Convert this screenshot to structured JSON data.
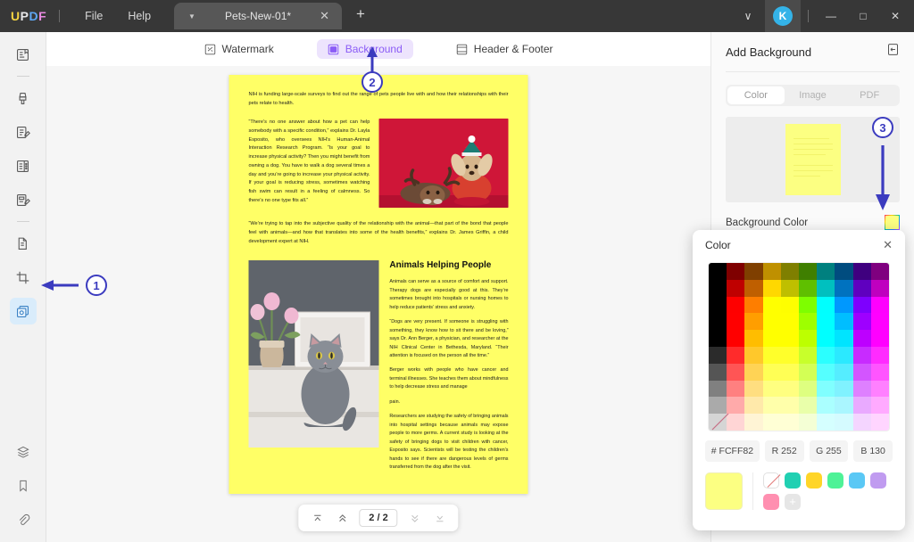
{
  "titlebar": {
    "logo": {
      "u": "U",
      "p": "P",
      "d": "D",
      "f": "F"
    },
    "menus": [
      "File",
      "Help"
    ],
    "tab": {
      "title": "Pets-New-01*",
      "caret_icon": "chevron-down-icon",
      "close_icon": "close-icon"
    },
    "new_tab_label": "+",
    "account_initial": "K",
    "window_buttons": {
      "minimize": "—",
      "maximize": "□",
      "close": "✕"
    },
    "overflow_caret": "∨"
  },
  "sidebar": {
    "items": [
      {
        "name": "reader-icon",
        "label": "Reader"
      },
      {
        "name": "annotate-icon",
        "label": "Annotate"
      },
      {
        "name": "edit-pdf-icon",
        "label": "Edit PDF"
      },
      {
        "name": "organize-pages-icon",
        "label": "Organize Pages"
      },
      {
        "name": "form-icon",
        "label": "Form"
      },
      {
        "name": "convert-pdf-icon",
        "label": "Convert PDF"
      },
      {
        "name": "crop-icon",
        "label": "Crop"
      },
      {
        "name": "page-background-icon",
        "label": "Background",
        "selected": true
      }
    ],
    "bottom_items": [
      {
        "name": "layers-icon",
        "label": "Layers"
      },
      {
        "name": "bookmark-icon",
        "label": "Bookmark"
      },
      {
        "name": "attachment-icon",
        "label": "Attachment"
      }
    ]
  },
  "subtoolbar": {
    "tabs": [
      {
        "label": "Watermark",
        "icon": "watermark-icon",
        "active": false
      },
      {
        "label": "Background",
        "icon": "background-icon",
        "active": true
      },
      {
        "label": "Header & Footer",
        "icon": "header-footer-icon",
        "active": false
      }
    ]
  },
  "document": {
    "lead": "NIH is funding large-scale surveys to find out the range of pets people live with and how their relationships with their pets relate to health.",
    "quote1": "“There’s no one answer about how a pet can help somebody with a  specific condition,” explains  Dr.  Layla  Esposito,  who oversees NIH’s Human-Animal  Interaction Research Program. “Is your goal to increase physical activity? Then you might benefit from owning a dog. You have to walk a dog several times a day and you’re going to increase your physical activity.  If your goal is reducing stress, sometimes watching fish swim can result in a feeling of calmness. So there’s no one type fits all.”",
    "quote2": "“We’re trying to tap into the subjective quality of the relationship with the animal—that part of the bond that people feel with animals—and how that translates into some of the health benefits,” explains Dr. James Griffin, a child development expert at NIH.",
    "heading2": "Animals Helping People",
    "body": [
      "Animals can serve as a source of comfort and support. Therapy dogs are especially good at this. They’re sometimes brought into hospitals or nursing homes to help reduce patients’ stress and anxiety.",
      "“Dogs are very present. If someone is struggling with something, they know how to sit there and be loving,”  says  Dr.  Ann Berger,  a  physician,  and researcher at the NIH Clinical Center in Bethesda, Maryland. “Their  attention  is  focused  on  the person all the time.”",
      "Berger works with people who have cancer and terminal illnesses.  She  teaches  them about mindfulness to help decrease stress and manage",
      "pain.",
      "Researchers are studying the safety of bringing animals into hospital settings because animals may expose people to more germs.  A  current study is looking at the safety of bringing dogs to visit children with cancer,  Esposito says. Scientists will be testing the children’s hands to see if there are dangerous levels of  germs transferred from the dog after the visit."
    ],
    "image1_alt": "two dogs in holiday costumes on red background",
    "image2_alt": "grey cat sitting on a desk next to tulips"
  },
  "pagenav": {
    "first_icon": "first-page-icon",
    "prev_icon": "previous-page-icon",
    "page_value": "2 / 2",
    "next_icon": "next-page-icon",
    "last_icon": "last-page-icon"
  },
  "right_panel": {
    "title": "Add Background",
    "expand_icon": "collapse-panel-icon",
    "segments": [
      {
        "label": "Color",
        "active": true
      },
      {
        "label": "Image",
        "active": false
      },
      {
        "label": "PDF",
        "active": false
      }
    ],
    "background_color_label": "Background Color",
    "background_color_value": "#FCFF82"
  },
  "color_dialog": {
    "title": "Color",
    "close_icon": "close-icon",
    "hex_label": "#",
    "hex_value": "FCFF82",
    "r_label": "R",
    "r_value": "252",
    "g_label": "G",
    "g_value": "255",
    "b_label": "B",
    "b_value": "130",
    "current_color": "#FCFF82",
    "palette_columns": [
      "#000000",
      "#7f0000",
      "#7f3f00",
      "#bf9000",
      "#7f7f00",
      "#3f7f00",
      "#00807f",
      "#004c7f",
      "#3f007f",
      "#7f007f"
    ],
    "recent_swatches": [
      {
        "name": "no-color-swatch",
        "color": "none"
      },
      {
        "name": "teal-swatch",
        "color": "#21d0b2"
      },
      {
        "name": "yellow-swatch",
        "color": "#ffd528"
      },
      {
        "name": "green-swatch",
        "color": "#4ef297"
      },
      {
        "name": "blue-swatch",
        "color": "#5ac8f5"
      },
      {
        "name": "purple-swatch",
        "color": "#c09bf0"
      },
      {
        "name": "pink-swatch",
        "color": "#ff8fb0"
      },
      {
        "name": "add-swatch",
        "color": "#e6e6e6"
      }
    ]
  },
  "annotations": [
    {
      "id": "1",
      "target": "sidebar-background-tool"
    },
    {
      "id": "2",
      "target": "background-subtab"
    },
    {
      "id": "3",
      "target": "background-color-swatch"
    }
  ]
}
